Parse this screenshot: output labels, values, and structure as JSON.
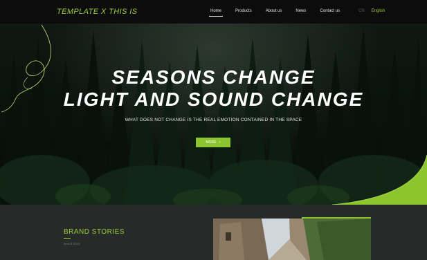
{
  "header": {
    "logo": "TEMPLATE X THIS IS",
    "nav": [
      {
        "label": "Home",
        "active": true
      },
      {
        "label": "Products"
      },
      {
        "label": "About us"
      },
      {
        "label": "News"
      },
      {
        "label": "Contact us"
      }
    ],
    "lang": {
      "secondary": "CN",
      "primary": "English"
    }
  },
  "hero": {
    "headline_1": "SEASONS CHANGE",
    "headline_2": "LIGHT AND SOUND CHANGE",
    "tagline": "WHAT DOES NOT CHANGE IS THE REAL EMOTION CONTAINED IN THE SPACE",
    "button": "MORE",
    "button_icon": "chevron-right-icon"
  },
  "brand": {
    "title": "BRAND STORIES",
    "subtitle": "Brand Story"
  },
  "colors": {
    "accent": "#8cc52e",
    "header_bg": "#0b0c0b",
    "section_bg": "#262a28"
  }
}
